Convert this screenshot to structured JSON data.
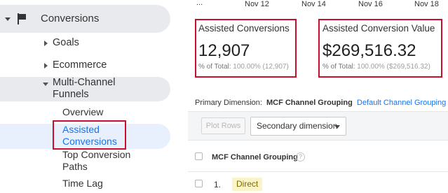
{
  "sidebar": {
    "conversions": "Conversions",
    "goals": "Goals",
    "ecommerce": "Ecommerce",
    "mcf_line1": "Multi-Channel",
    "mcf_line2": "Funnels",
    "overview": "Overview",
    "assisted_line1": "Assisted",
    "assisted_line2": "Conversions",
    "top_line1": "Top Conversion",
    "top_line2": "Paths",
    "time_lag": "Time Lag"
  },
  "chart_axis": {
    "ellipsis": "...",
    "dates": [
      "Nov 12",
      "Nov 14",
      "Nov 16",
      "Nov 18"
    ]
  },
  "metrics": {
    "assisted_conversions": {
      "title": "Assisted Conversions",
      "value": "12,907",
      "total_prefix": "% of Total: ",
      "total_pct": "100.00% (12,907)"
    },
    "assisted_value": {
      "title": "Assisted Conversion Value",
      "value": "$269,516.32",
      "total_prefix": "% of Total: ",
      "total_pct": "100.00% ($269,516.32)"
    }
  },
  "dimension": {
    "primary_label": "Primary Dimension:",
    "primary_value": "MCF Channel Grouping",
    "default_link": "Default Channel Grouping"
  },
  "toolbar": {
    "plot_rows": "Plot Rows",
    "secondary_dimension": "Secondary dimension"
  },
  "table": {
    "header": "MCF Channel Grouping",
    "help": "?",
    "rows": [
      {
        "index": "1.",
        "channel": "Direct"
      }
    ]
  },
  "colors": {
    "highlight_border": "#c8102e",
    "link": "#1a73e8",
    "chip_bg": "#fbf4c8"
  }
}
